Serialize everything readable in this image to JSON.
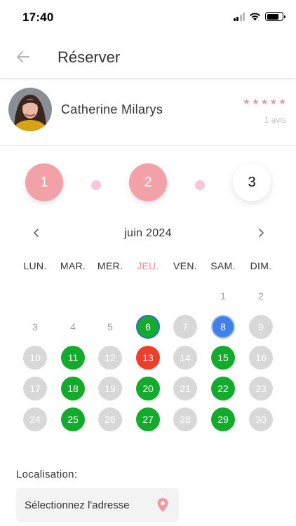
{
  "status_bar": {
    "time": "17:40"
  },
  "header": {
    "title": "Réserver"
  },
  "provider": {
    "name": "Catherine Milarys",
    "rating": 5,
    "reviews_text": "1 avis"
  },
  "stepper": {
    "steps": [
      {
        "label": "1",
        "state": "done"
      },
      {
        "label": "2",
        "state": "done"
      },
      {
        "label": "3",
        "state": "current"
      }
    ]
  },
  "calendar": {
    "month_label": "juin 2024",
    "weekdays": [
      "LUN.",
      "MAR.",
      "MER.",
      "JEU.",
      "VEN.",
      "SAM.",
      "DIM."
    ],
    "today_weekday_index": 3,
    "leading_blank_days": 5,
    "days": [
      {
        "day": "1",
        "status": "past"
      },
      {
        "day": "2",
        "status": "past"
      },
      {
        "day": "3",
        "status": "past"
      },
      {
        "day": "4",
        "status": "past"
      },
      {
        "day": "5",
        "status": "past"
      },
      {
        "day": "6",
        "status": "today"
      },
      {
        "day": "7",
        "status": "unavailable"
      },
      {
        "day": "8",
        "status": "selected"
      },
      {
        "day": "9",
        "status": "unavailable"
      },
      {
        "day": "10",
        "status": "unavailable"
      },
      {
        "day": "11",
        "status": "available"
      },
      {
        "day": "12",
        "status": "unavailable"
      },
      {
        "day": "13",
        "status": "holiday"
      },
      {
        "day": "14",
        "status": "unavailable"
      },
      {
        "day": "15",
        "status": "available"
      },
      {
        "day": "16",
        "status": "unavailable"
      },
      {
        "day": "17",
        "status": "unavailable"
      },
      {
        "day": "18",
        "status": "available"
      },
      {
        "day": "19",
        "status": "unavailable"
      },
      {
        "day": "20",
        "status": "available"
      },
      {
        "day": "21",
        "status": "unavailable"
      },
      {
        "day": "22",
        "status": "available"
      },
      {
        "day": "23",
        "status": "unavailable"
      },
      {
        "day": "24",
        "status": "unavailable"
      },
      {
        "day": "25",
        "status": "available"
      },
      {
        "day": "26",
        "status": "unavailable"
      },
      {
        "day": "27",
        "status": "available"
      },
      {
        "day": "28",
        "status": "unavailable"
      },
      {
        "day": "29",
        "status": "available"
      },
      {
        "day": "30",
        "status": "unavailable"
      }
    ]
  },
  "location": {
    "label": "Localisation:",
    "address_placeholder": "Sélectionnez l'adresse"
  },
  "icons": {
    "back": "arrow-left-icon",
    "prev": "chevron-left-icon",
    "next": "chevron-right-icon",
    "pin": "location-pin-icon"
  },
  "colors": {
    "accent_pink": "#f3a1a9",
    "available_green": "#12ab2c",
    "selected_blue": "#3f80ea",
    "holiday_red": "#ec3f2c",
    "unavailable_grey": "#d8d8d8"
  }
}
